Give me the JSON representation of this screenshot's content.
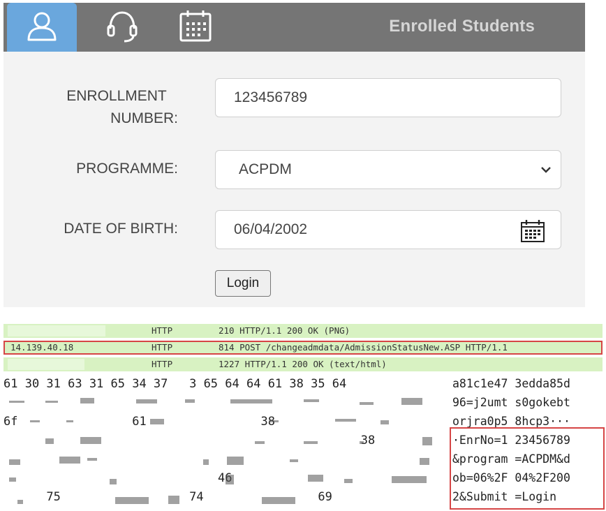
{
  "header": {
    "title": "Enrolled Students",
    "tabs": [
      {
        "icon": "user-icon",
        "active": true
      },
      {
        "icon": "headset-icon",
        "active": false
      },
      {
        "icon": "calendar-icon",
        "active": false
      }
    ],
    "colors": {
      "bar": "#757575",
      "active_tab": "#6aa7dd"
    }
  },
  "form": {
    "enrollment_label_line1": "ENROLLMENT",
    "enrollment_label_line2": "NUMBER:",
    "enrollment_value": "123456789",
    "programme_label": "PROGRAMME:",
    "programme_value": "ACPDM",
    "dob_label": "DATE OF BIRTH:",
    "dob_value": "06/04/2002",
    "login_label": "Login"
  },
  "capture": {
    "rows": [
      {
        "source": "",
        "protocol": "HTTP",
        "info": "210 HTTP/1.1 200 OK  (PNG)"
      },
      {
        "source": "14.139.40.18",
        "protocol": "HTTP",
        "info": "814 POST /changeadmdata/AdmissionStatusNew.ASP HTTP/1.1"
      },
      {
        "source": "",
        "protocol": "HTTP",
        "info": "1227 HTTP/1.1 200 OK  (text/html)"
      }
    ],
    "hex_lines": [
      "61 30 31 63 31 65 34 37   3 65 64 64 61 38 35 64",
      "",
      "6f                61                38             ",
      "                                                  38",
      "",
      "                              46                   ",
      "      75                  74                69"
    ],
    "ascii_lines": [
      "a81c1e47 3edda85d",
      "96=j2umt s0gokebt",
      "orjra0p5 8hcp3···",
      "·EnrNo=1 23456789",
      "&program =ACPDM&d",
      "ob=06%2F 04%2F200",
      "2&Submit =Login"
    ]
  }
}
